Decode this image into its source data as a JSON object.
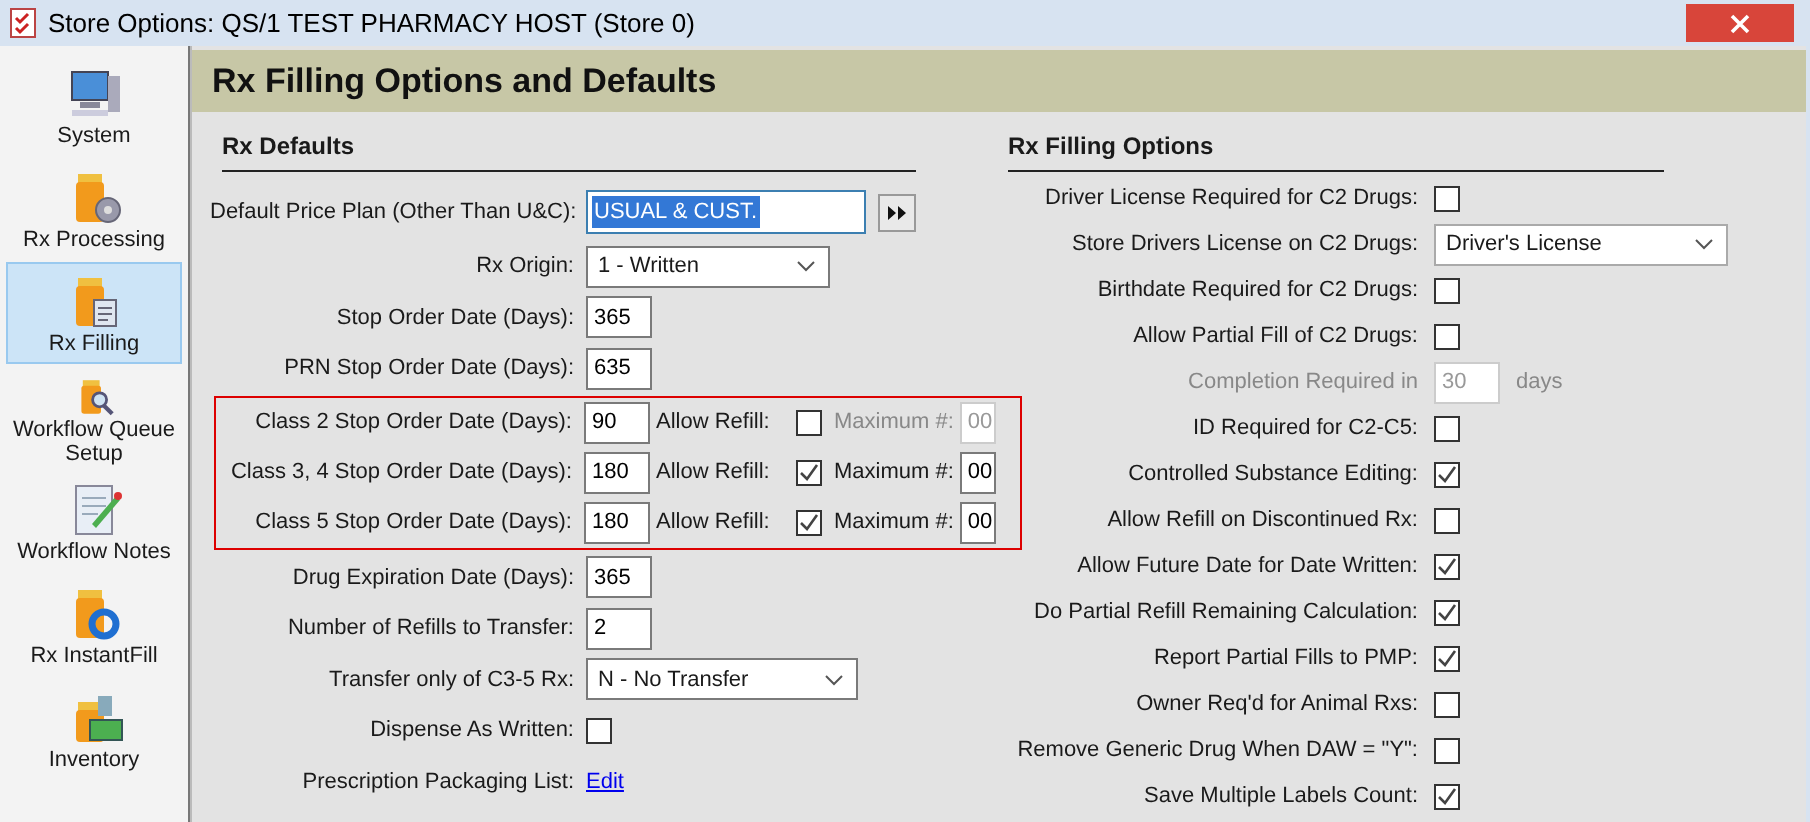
{
  "window": {
    "title": "Store Options: QS/1 TEST PHARMACY HOST (Store 0)"
  },
  "sidebar": {
    "items": [
      {
        "kind": "monitor",
        "label": "System",
        "selected": false
      },
      {
        "kind": "gears",
        "label": "Rx Processing",
        "selected": false
      },
      {
        "kind": "doc",
        "label": "Rx Filling",
        "selected": true
      },
      {
        "kind": "magnifier",
        "label": "Workflow Queue Setup",
        "selected": false
      },
      {
        "kind": "notes",
        "label": "Workflow Notes",
        "selected": false
      },
      {
        "kind": "ring",
        "label": "Rx InstantFill",
        "selected": false
      },
      {
        "kind": "boxes",
        "label": "Inventory",
        "selected": false
      }
    ]
  },
  "header": {
    "title": "Rx Filling Options and Defaults"
  },
  "rx_defaults": {
    "title": "Rx Defaults",
    "rows": [
      {
        "kind": "price_plan",
        "label": "Default Price Plan (Other Than U&C):",
        "value": "USUAL & CUST."
      },
      {
        "kind": "dropdown",
        "label": "Rx Origin:",
        "value": "1 - Written"
      },
      {
        "kind": "text",
        "label": "Stop Order Date (Days):",
        "value": "365"
      },
      {
        "kind": "text",
        "label": "PRN Stop Order Date (Days):",
        "value": "635"
      },
      {
        "kind": "group",
        "items": [
          {
            "label": "Class 2 Stop Order Date (Days):",
            "value": "90",
            "refill_label": "Allow Refill:",
            "allow_refill": false,
            "max_label": "Maximum #:",
            "max_value": "00",
            "disabled": true
          },
          {
            "label": "Class 3, 4 Stop Order Date (Days):",
            "value": "180",
            "refill_label": "Allow Refill:",
            "allow_refill": true,
            "max_label": "Maximum #:",
            "max_value": "00",
            "disabled": false
          },
          {
            "label": "Class 5 Stop Order Date (Days):",
            "value": "180",
            "refill_label": "Allow Refill:",
            "allow_refill": true,
            "max_label": "Maximum #:",
            "max_value": "00",
            "disabled": false
          }
        ]
      },
      {
        "kind": "text",
        "label": "Drug Expiration Date (Days):",
        "value": "365"
      },
      {
        "kind": "text",
        "label": "Number of Refills to Transfer:",
        "value": "2"
      },
      {
        "kind": "dropdown_wide",
        "label": "Transfer only of C3-5 Rx:",
        "value": "N - No Transfer"
      },
      {
        "kind": "checkbox",
        "label": "Dispense As Written:",
        "checked": false
      },
      {
        "kind": "link",
        "label": "Prescription Packaging List:",
        "value": "Edit"
      }
    ]
  },
  "rx_filling_options": {
    "title": "Rx Filling Options",
    "rows": [
      {
        "kind": "checkbox",
        "label": "Driver License Required for C2 Drugs:",
        "checked": false
      },
      {
        "kind": "dropdown",
        "label": "Store Drivers License on C2 Drugs:",
        "value": "Driver's License"
      },
      {
        "kind": "checkbox",
        "label": "Birthdate Required for C2 Drugs:",
        "checked": false
      },
      {
        "kind": "checkbox",
        "label": "Allow Partial Fill of C2 Drugs:",
        "checked": false
      },
      {
        "kind": "days",
        "label": "Completion Required in",
        "value": "30",
        "suffix": "days",
        "disabled": true
      },
      {
        "kind": "checkbox",
        "label": "ID Required for C2-C5:",
        "checked": false
      },
      {
        "kind": "checkbox",
        "label": "Controlled Substance Editing:",
        "checked": true
      },
      {
        "kind": "checkbox",
        "label": "Allow Refill on Discontinued Rx:",
        "checked": false
      },
      {
        "kind": "checkbox",
        "label": "Allow Future Date for Date Written:",
        "checked": true
      },
      {
        "kind": "checkbox",
        "label": "Do Partial Refill Remaining Calculation:",
        "checked": true
      },
      {
        "kind": "checkbox",
        "label": "Report Partial Fills to PMP:",
        "checked": true
      },
      {
        "kind": "checkbox",
        "label": "Owner Req'd for Animal Rxs:",
        "checked": false
      },
      {
        "kind": "checkbox",
        "label": "Remove Generic Drug When DAW = \"Y\":",
        "checked": false
      },
      {
        "kind": "checkbox",
        "label": "Save Multiple Labels Count:",
        "checked": true
      }
    ]
  }
}
